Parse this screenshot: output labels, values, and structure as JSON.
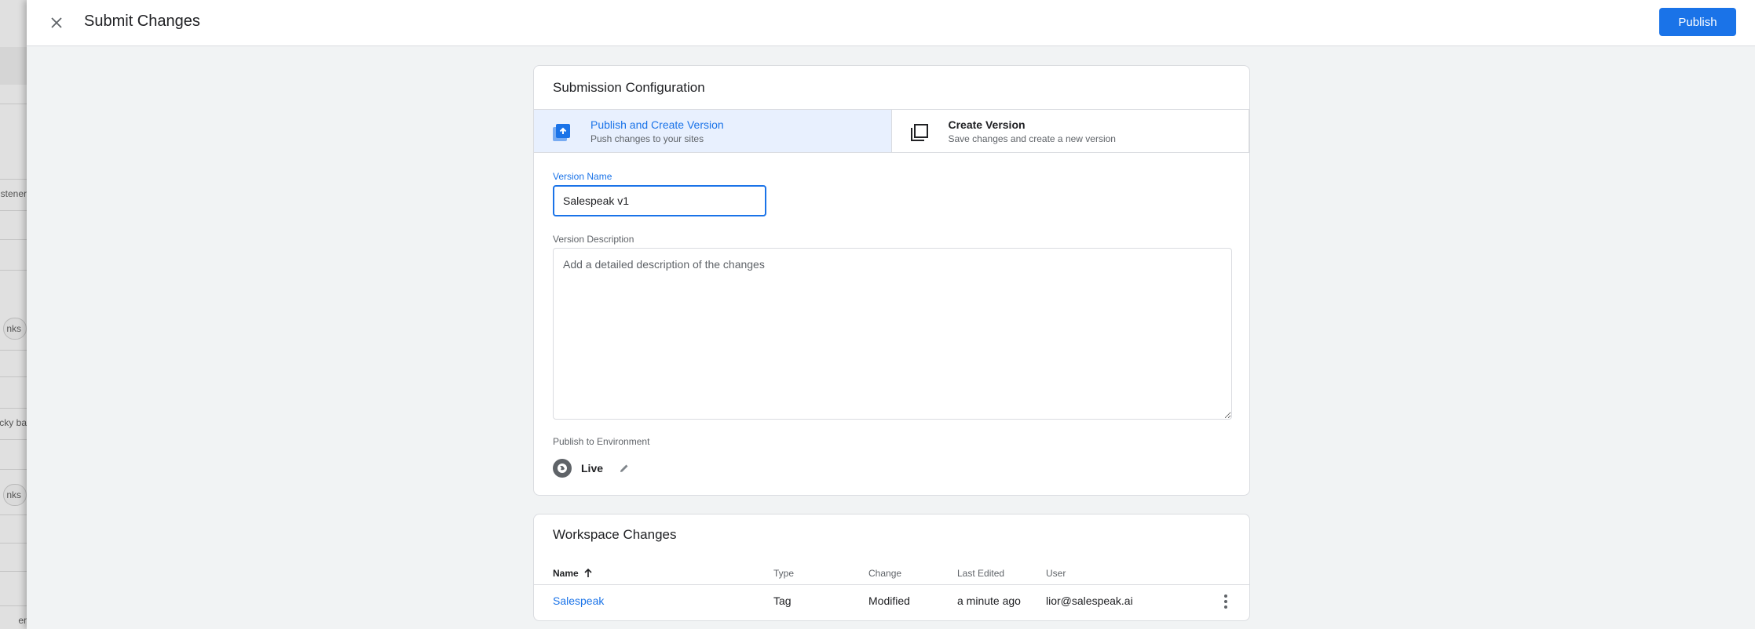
{
  "background": {
    "texts": [
      "stener",
      "nks",
      "icky ba",
      "nks",
      "er"
    ]
  },
  "topbar": {
    "title": "Submit Changes",
    "publish_label": "Publish"
  },
  "submission": {
    "title": "Submission Configuration",
    "options": [
      {
        "label": "Publish and Create Version",
        "sub": "Push changes to your sites",
        "icon": "publish-icon",
        "selected": true
      },
      {
        "label": "Create Version",
        "sub": "Save changes and create a new version",
        "icon": "copy-icon",
        "selected": false
      }
    ],
    "version_name_label": "Version Name",
    "version_name_value": "Salespeak v1",
    "version_description_label": "Version Description",
    "version_description_placeholder": "Add a detailed description of the changes",
    "environment_label": "Publish to Environment",
    "environment_name": "Live"
  },
  "workspace": {
    "title": "Workspace Changes",
    "columns": [
      "Name",
      "Type",
      "Change",
      "Last Edited",
      "User"
    ],
    "rows": [
      {
        "name": "Salespeak",
        "type": "Tag",
        "change": "Modified",
        "last_edited": "a minute ago",
        "user": "lior@salespeak.ai"
      }
    ]
  },
  "colors": {
    "accent": "#1a73e8",
    "selected_bg": "#e8f0fe"
  }
}
